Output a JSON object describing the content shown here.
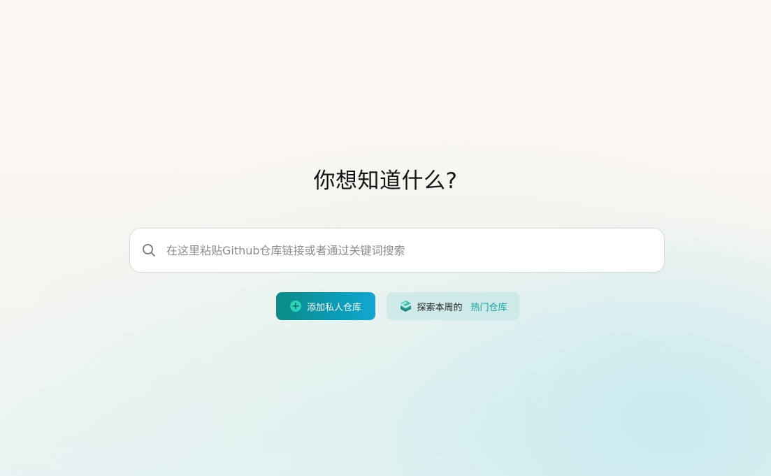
{
  "hero": {
    "title": "你想知道什么?"
  },
  "search": {
    "placeholder": "在这里粘贴Github仓库链接或者通过关键词搜索",
    "value": ""
  },
  "actions": {
    "add_private_label": "添加私人仓库",
    "explore_prefix": "探索本周的",
    "explore_highlight": "热门仓库"
  },
  "colors": {
    "primary_gradient_start": "#0d8a86",
    "primary_gradient_end": "#14a6d0",
    "accent_text": "#12a6a0",
    "secondary_bg": "#cde9e8"
  },
  "icons": {
    "search": "search-icon",
    "add": "plus-circle-icon",
    "explore": "book-stack-icon"
  }
}
